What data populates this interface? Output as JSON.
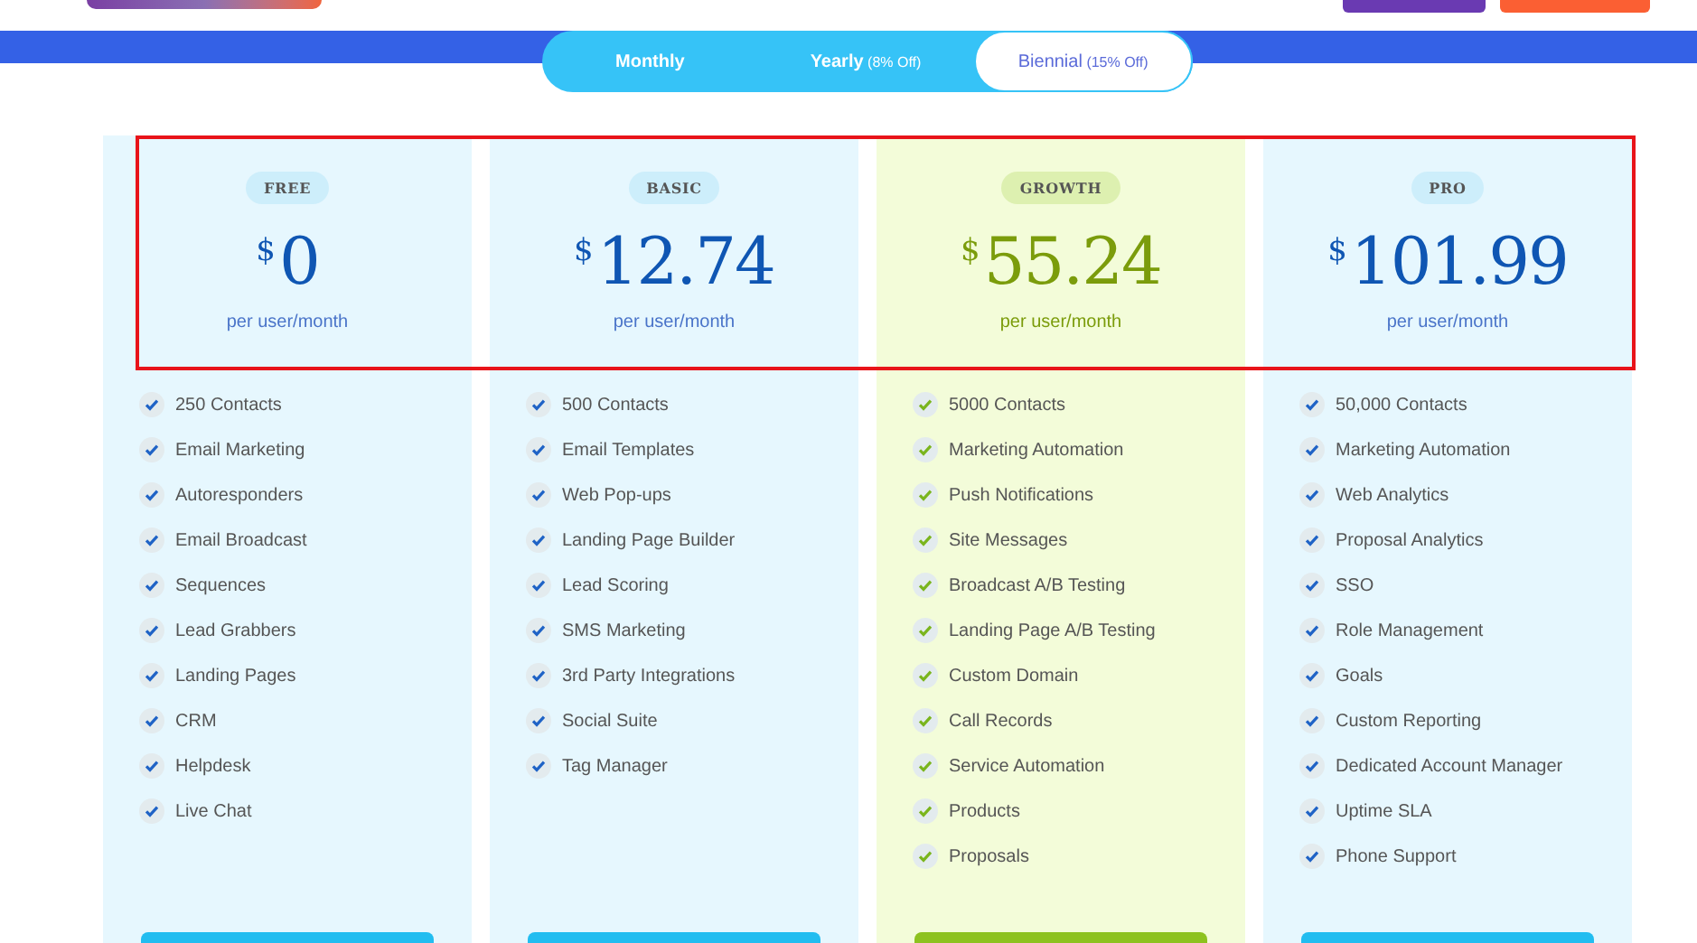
{
  "billing_tabs": [
    {
      "label": "Monthly",
      "selected": false
    },
    {
      "label": "Yearly",
      "note": "(8% Off)",
      "selected": false
    },
    {
      "label": "Biennial",
      "note": "(15% Off)",
      "selected": true
    }
  ],
  "plans": [
    {
      "name": "FREE",
      "kind": "standard",
      "currency": "$",
      "price": "0",
      "period": "per user/month",
      "features": [
        "250 Contacts",
        "Email Marketing",
        "Autoresponders",
        "Email Broadcast",
        "Sequences",
        "Lead Grabbers",
        "Landing Pages",
        "CRM",
        "Helpdesk",
        "Live Chat"
      ]
    },
    {
      "name": "BASIC",
      "kind": "standard",
      "currency": "$",
      "price": "12.74",
      "period": "per user/month",
      "features": [
        "500 Contacts",
        "Email Templates",
        "Web Pop-ups",
        "Landing Page Builder",
        "Lead Scoring",
        "SMS Marketing",
        "3rd Party Integrations",
        "Social Suite",
        "Tag Manager"
      ]
    },
    {
      "name": "GROWTH",
      "kind": "featured",
      "currency": "$",
      "price": "55.24",
      "period": "per user/month",
      "features": [
        "5000 Contacts",
        "Marketing Automation",
        "Push Notifications",
        "Site Messages",
        "Broadcast A/B Testing",
        "Landing Page A/B Testing",
        "Custom Domain",
        "Call Records",
        "Service Automation",
        "Products",
        "Proposals"
      ]
    },
    {
      "name": "PRO",
      "kind": "standard",
      "currency": "$",
      "price": "101.99",
      "period": "per user/month",
      "features": [
        "50,000 Contacts",
        "Marketing Automation",
        "Web Analytics",
        "Proposal Analytics",
        "SSO",
        "Role Management",
        "Goals",
        "Custom Reporting",
        "Dedicated Account Manager",
        "Uptime SLA",
        "Phone Support"
      ]
    }
  ]
}
